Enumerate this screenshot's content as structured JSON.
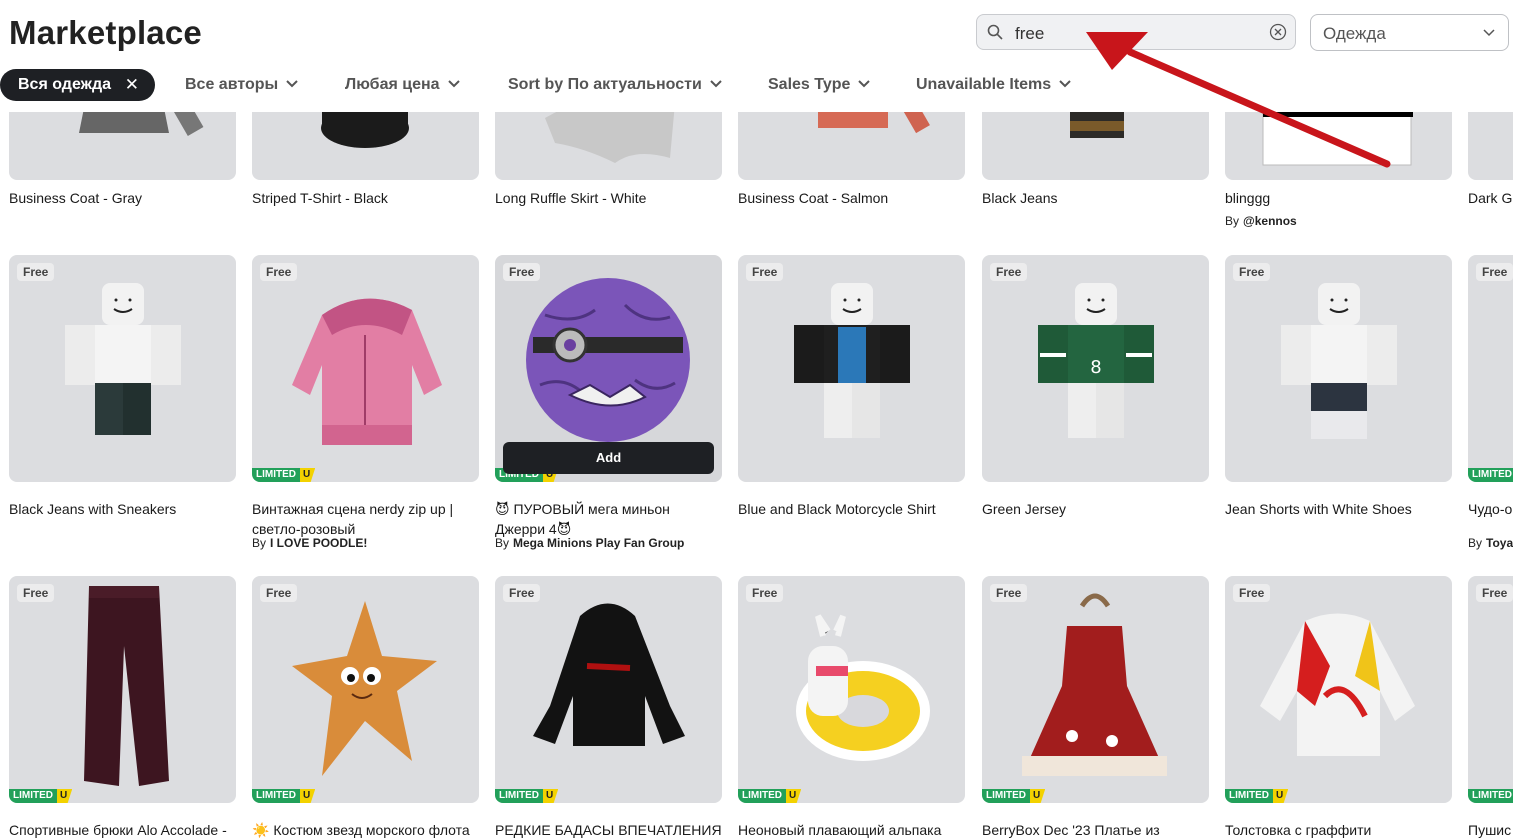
{
  "header": {
    "title": "Marketplace",
    "search_value": "free",
    "category": "Одежда"
  },
  "filters": {
    "active_chip": "Вся одежда",
    "items": [
      "Все авторы",
      "Любая цена",
      "Sort by По актуальности",
      "Sales Type",
      "Unavailable Items"
    ]
  },
  "badges": {
    "free": "Free",
    "limited": "LIMITED",
    "u": "U"
  },
  "add_label": "Add",
  "by_prefix": "By",
  "row0": [
    {
      "name": "Business Coat - Gray"
    },
    {
      "name": "Striped T-Shirt - Black"
    },
    {
      "name": "Long Ruffle Skirt - White"
    },
    {
      "name": "Business Coat - Salmon"
    },
    {
      "name": "Black Jeans"
    },
    {
      "name": "blinggg",
      "by": "@kennos"
    },
    {
      "name": "Dark Gr"
    }
  ],
  "row1": [
    {
      "name": "Black Jeans with Sneakers"
    },
    {
      "name": "Винтажная сцена nerdy zip up | светло-розовый",
      "by": "I LOVE POODLE!"
    },
    {
      "name": "😈 ПУРОВЫЙ мега миньон Джерри 4😈",
      "by": "Mega Minions Play Fan Group"
    },
    {
      "name": "Blue and Black Motorcycle Shirt"
    },
    {
      "name": "Green Jersey"
    },
    {
      "name": "Jean Shorts with White Shoes"
    },
    {
      "name": "Чудо-о Марин",
      "by": "Toya"
    }
  ],
  "row2": [
    {
      "name": "Спортивные брюки Alo Accolade -"
    },
    {
      "name": "☀️ Костюм звезд морского флота"
    },
    {
      "name": "РЕДКИЕ БАДАСЫ ВПЕЧАТЛЕНИЯ"
    },
    {
      "name": "Неоновый плавающий альпака"
    },
    {
      "name": "BerryBox Dec '23 Платье из"
    },
    {
      "name": "Толстовка с граффити"
    },
    {
      "name": "Пушис"
    }
  ],
  "colors": {
    "accent_dark": "#1e2024",
    "arrow": "#c8151b",
    "limited_green": "#22a05a",
    "limited_yellow": "#f3d200"
  }
}
